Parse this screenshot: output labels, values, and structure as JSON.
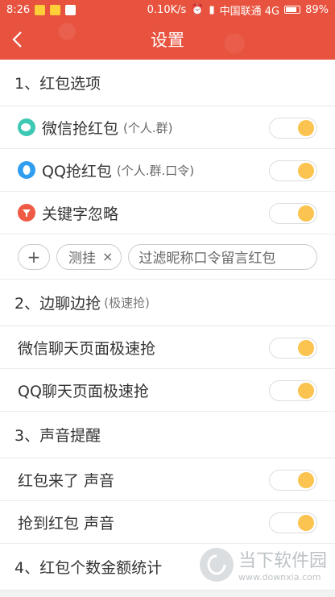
{
  "statusbar": {
    "time": "8:26",
    "speed": "0.10K/s",
    "carrier": "中国联通 4G",
    "battery": "89%"
  },
  "header": {
    "title": "设置"
  },
  "sections": {
    "redpack": {
      "title": "1、红包选项",
      "wechat_label": "微信抢红包",
      "wechat_sub": "(个人.群)",
      "qq_label": "QQ抢红包",
      "qq_sub": "(个人.群.口令)",
      "keyword_label": "关键字忽略",
      "chip_label": "测挂",
      "chip_remove": "×",
      "filter_placeholder": "过滤昵称口令留言红包",
      "plus": "+"
    },
    "fast": {
      "title": "2、边聊边抢",
      "title_sub": "(极速抢)",
      "wechat_fast": "微信聊天页面极速抢",
      "qq_fast": "QQ聊天页面极速抢"
    },
    "sound": {
      "title": "3、声音提醒",
      "incoming": "红包来了 声音",
      "grabbed": "抢到红包 声音"
    },
    "stats": {
      "title": "4、红包个数金额统计"
    }
  },
  "watermark": {
    "name": "当下软件园",
    "url": "www.downxia.com"
  },
  "colors": {
    "accent": "#e8533f",
    "toggle_knob": "#fbc34f"
  }
}
